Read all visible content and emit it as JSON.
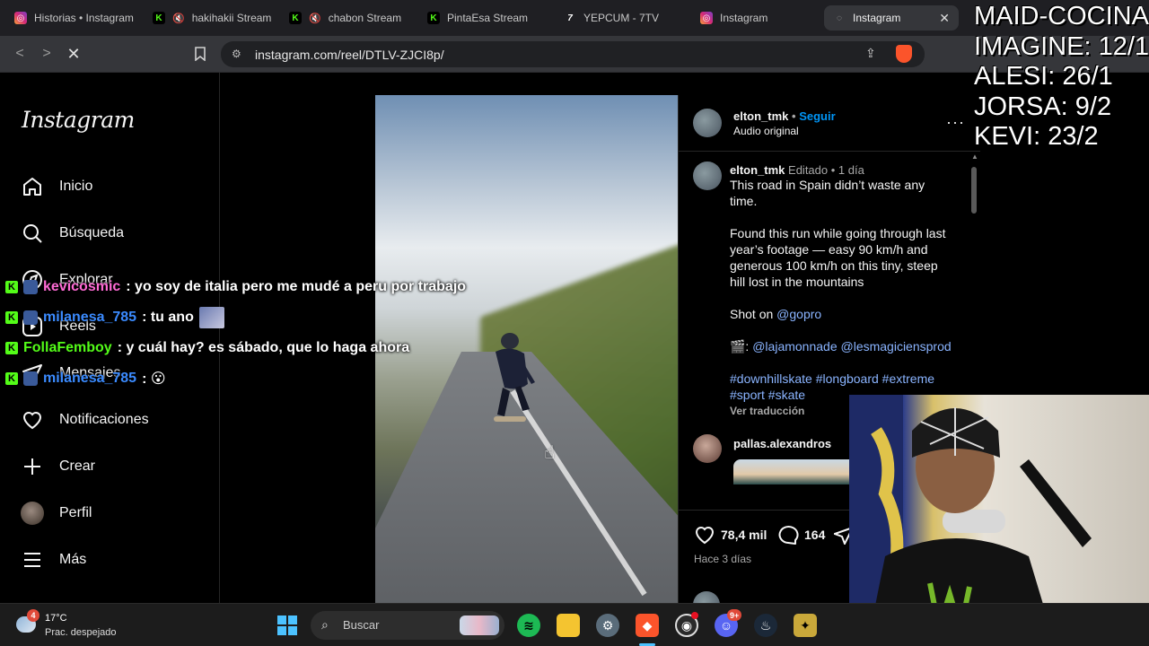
{
  "browser": {
    "tabs": [
      {
        "label": "Historias • Instagram",
        "favicon": "instagram-icon"
      },
      {
        "label": "hakihakii Stream",
        "favicon": "kick-icon"
      },
      {
        "label": "chabon Stream",
        "favicon": "kick-icon"
      },
      {
        "label": "PintaEsa Stream",
        "favicon": "kick-icon"
      },
      {
        "label": "YEPCUM - 7TV",
        "favicon": "7tv-icon"
      },
      {
        "label": "Instagram",
        "favicon": "instagram-icon"
      },
      {
        "label": "Instagram",
        "favicon": "loading-icon",
        "active": true
      }
    ],
    "url": "instagram.com/reel/DTLV-ZJCI8p/"
  },
  "sidebar": {
    "logo": "Instagram",
    "items": [
      {
        "label": "Inicio",
        "icon": "home-icon"
      },
      {
        "label": "Búsqueda",
        "icon": "search-icon"
      },
      {
        "label": "Explorar",
        "icon": "explore-icon"
      },
      {
        "label": "Reels",
        "icon": "reels-icon"
      },
      {
        "label": "Mensajes",
        "icon": "messages-icon"
      },
      {
        "label": "Notificaciones",
        "icon": "heart-icon"
      },
      {
        "label": "Crear",
        "icon": "plus-icon"
      },
      {
        "label": "Perfil",
        "icon": "avatar"
      },
      {
        "label": "Más",
        "icon": "menu-icon"
      }
    ]
  },
  "post": {
    "author": "elton_tmk",
    "follow": "Seguir",
    "audio": "Audio original",
    "caption_meta_edited": "Editado",
    "caption_meta_time": "1 día",
    "caption_lines": [
      "This road in Spain didn’t waste any",
      "time."
    ],
    "caption_p2": [
      "Found this run while going through last",
      "year’s footage — easy 90 km/h and",
      "generous 100 km/h on this tiny, steep",
      "hill lost in the mountains"
    ],
    "shot_on": "Shot on",
    "shot_on_link": "@gopro",
    "credits_prefix": "🎬:",
    "credits_links": "@lajamonnade @lesmagiciensprod",
    "hashtags_1": "#downhillskate #longboard #extreme",
    "hashtags_2": "#sport #skate",
    "translate": "Ver traducción",
    "comment_author": "pallas.alexandros",
    "likes": "78,4 mil",
    "comments": "164",
    "date": "Hace 3 días"
  },
  "chat": [
    {
      "user": "kevicosmic",
      "user_color": "#ff6bd5",
      "message": ": yo soy de italia pero me mudé a peru por trabajo"
    },
    {
      "user": "milanesa_785",
      "user_color": "#3b8bff",
      "message": ": tu ano"
    },
    {
      "user": "FollaFemboy",
      "user_color": "#53fc18",
      "message": ": y cuál hay? es sábado, que lo haga ahora"
    },
    {
      "user": "milanesa_785",
      "user_color": "#3b8bff",
      "message": ": 😮"
    }
  ],
  "scores": [
    "MAID-COCINA",
    "IMAGINE: 12/1",
    "ALESI: 26/1",
    "JORSA: 9/2",
    "KEVI: 23/2"
  ],
  "taskbar": {
    "weather_temp": "17°C",
    "weather_desc": "Prac. despejado",
    "weather_badge": "4",
    "search_placeholder": "Buscar",
    "discord_badge": "9+"
  }
}
